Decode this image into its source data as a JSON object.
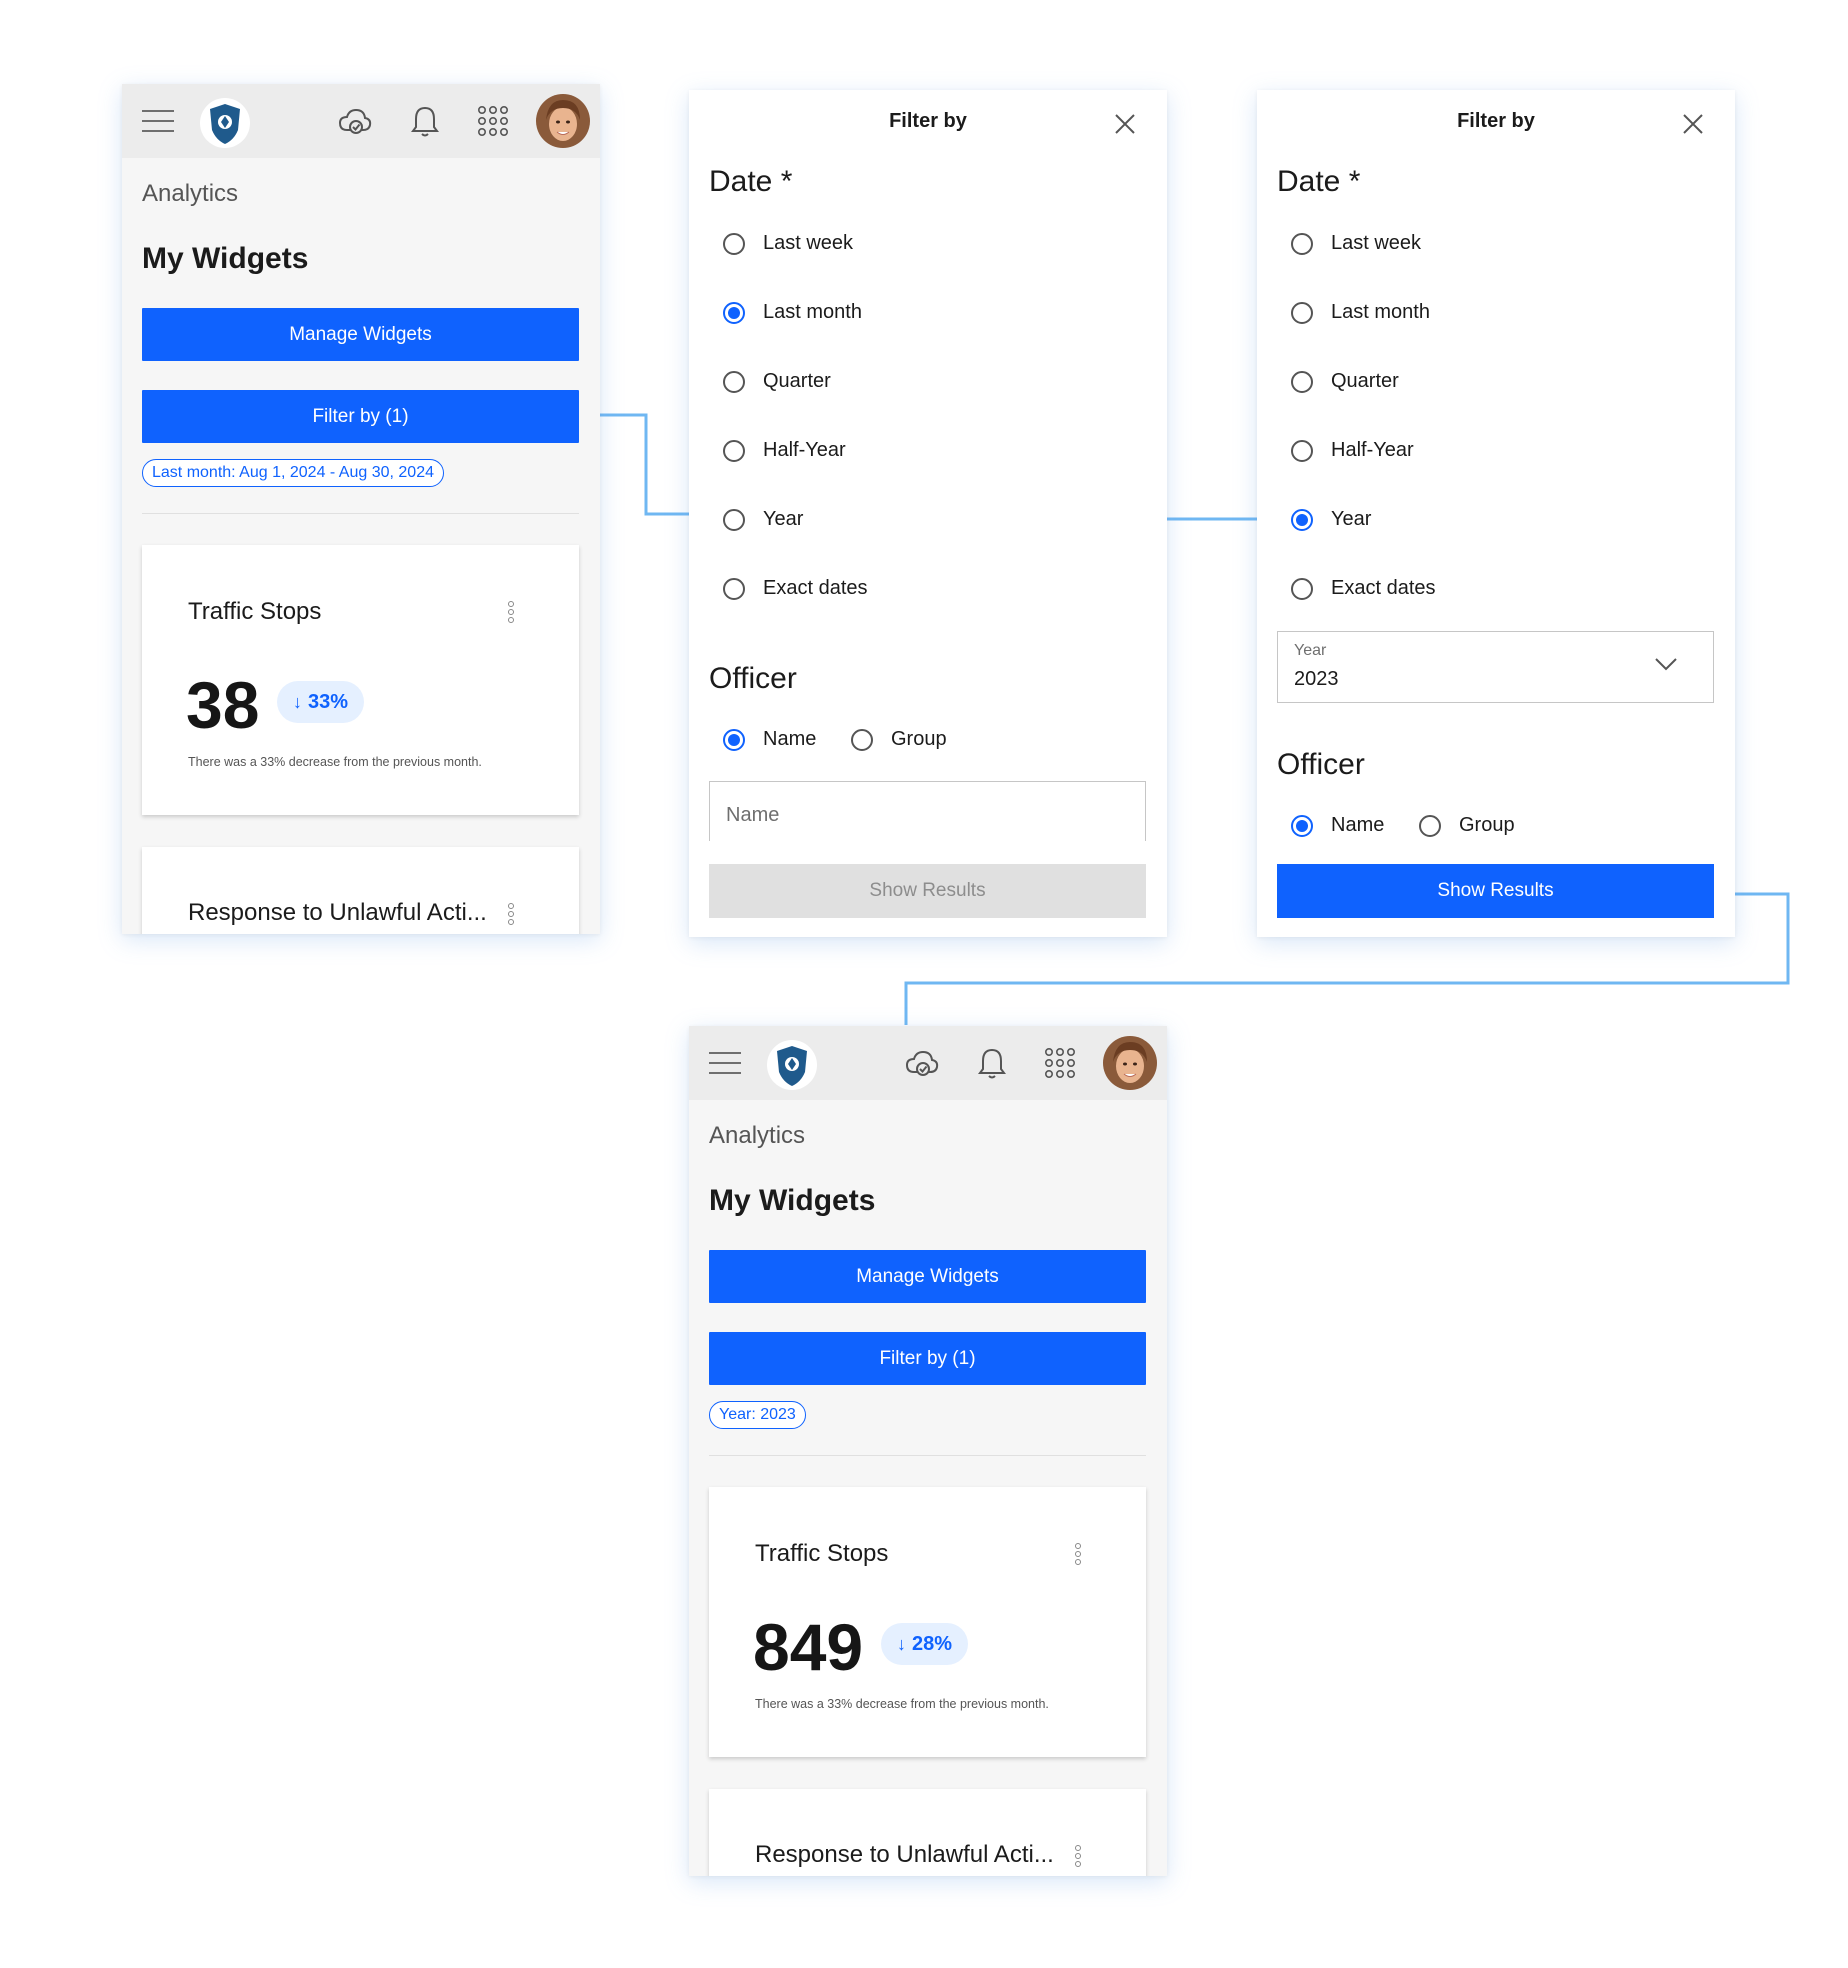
{
  "colors": {
    "accent": "#0f62fe",
    "connector": "#6fb7f2",
    "pill_bg": "#e5f0ff"
  },
  "screen1": {
    "topbar_icons": [
      "menu-icon",
      "liberty-police-badge-logo",
      "cloud-sync-icon",
      "bell-icon",
      "app-grid-icon",
      "user-avatar"
    ],
    "section": "Analytics",
    "title": "My Widgets",
    "manage_label": "Manage Widgets",
    "filter_label": "Filter by (1)",
    "chip": "Last month: Aug 1, 2024 - Aug 30, 2024",
    "card1": {
      "title": "Traffic Stops",
      "value": "38",
      "change": "33%",
      "change_icon": "arrow-down-icon",
      "note": "There was a 33% decrease from the previous month."
    },
    "card2": {
      "title": "Response to Unlawful Acti..."
    }
  },
  "filter1": {
    "title": "Filter by",
    "date_heading": "Date *",
    "date_options": [
      "Last week",
      "Last month",
      "Quarter",
      "Half-Year",
      "Year",
      "Exact dates"
    ],
    "date_selected": "Last month",
    "officer_heading": "Officer",
    "officer_options": [
      "Name",
      "Group"
    ],
    "officer_selected": "Name",
    "name_placeholder": "Name",
    "show_label": "Show Results",
    "show_enabled": false
  },
  "filter2": {
    "title": "Filter by",
    "date_heading": "Date *",
    "date_options": [
      "Last week",
      "Last month",
      "Quarter",
      "Half-Year",
      "Year",
      "Exact dates"
    ],
    "date_selected": "Year",
    "year_label": "Year",
    "year_value": "2023",
    "officer_heading": "Officer",
    "officer_options": [
      "Name",
      "Group"
    ],
    "officer_selected": "Name",
    "show_label": "Show Results",
    "show_enabled": true
  },
  "screen2": {
    "section": "Analytics",
    "title": "My Widgets",
    "manage_label": "Manage Widgets",
    "filter_label": "Filter by (1)",
    "chip": "Year: 2023",
    "card1": {
      "title": "Traffic Stops",
      "value": "849",
      "change": "28%",
      "change_icon": "arrow-down-icon",
      "note": "There was a 33% decrease from the previous month."
    },
    "card2": {
      "title": "Response to Unlawful Acti..."
    }
  }
}
